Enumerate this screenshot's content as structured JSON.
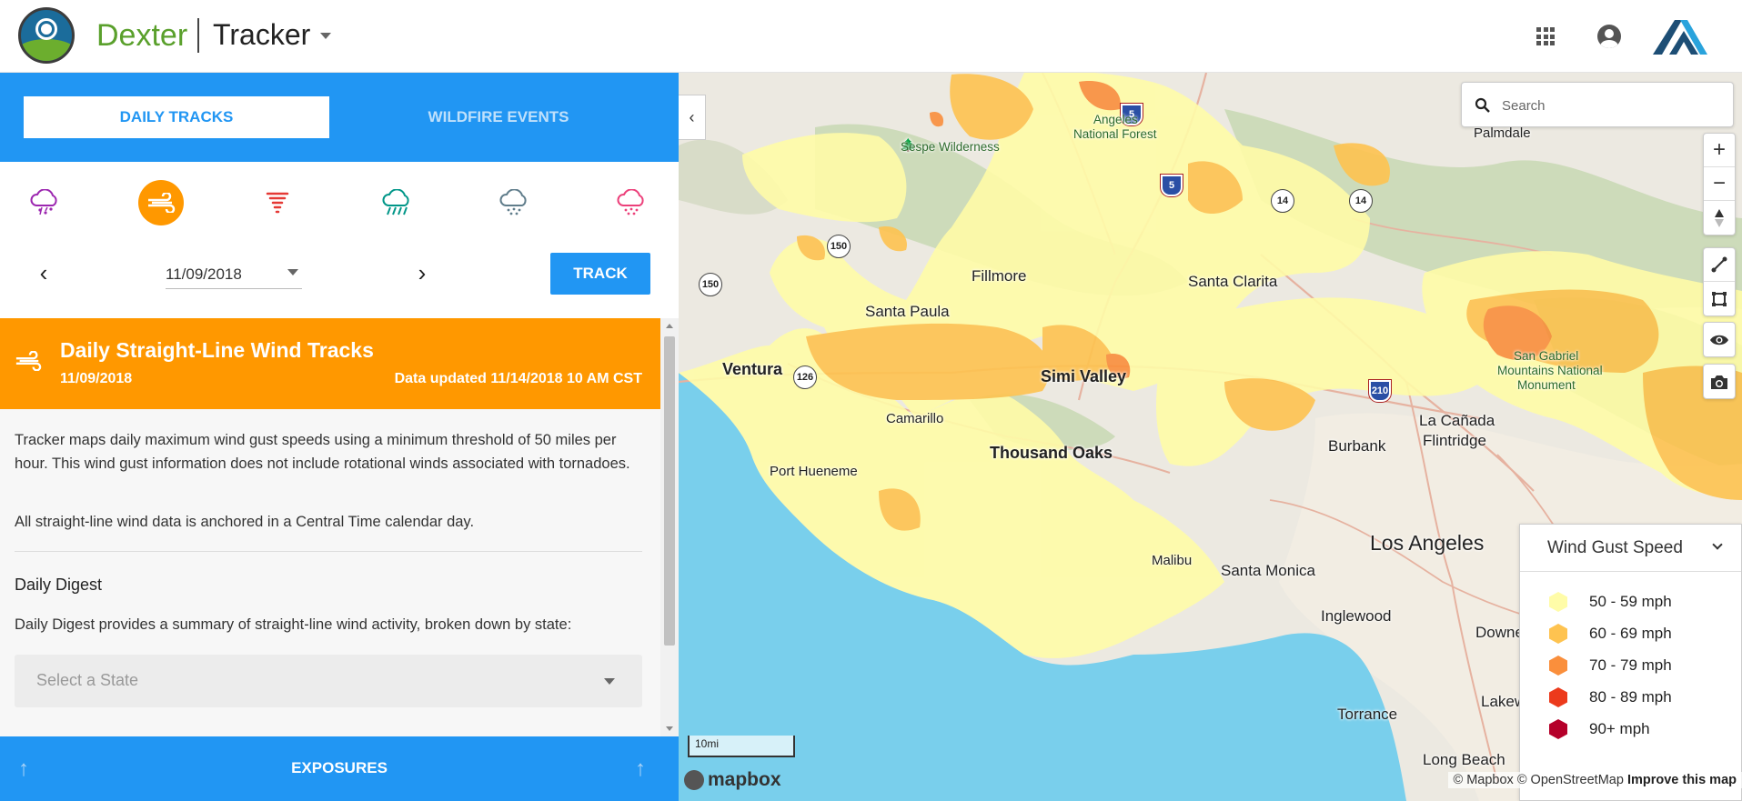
{
  "header": {
    "brand": "Dexter",
    "app_name": "Tracker"
  },
  "left_panel": {
    "tabs": [
      {
        "label": "DAILY TRACKS",
        "active": true
      },
      {
        "label": "WILDFIRE EVENTS",
        "active": false
      }
    ],
    "hazard_icons": [
      {
        "icon": "hail-icon",
        "color": "#9c27b0",
        "active": false
      },
      {
        "icon": "wind-icon",
        "color": "#ff9800",
        "active": true
      },
      {
        "icon": "tornado-icon",
        "color": "#e53935",
        "active": false
      },
      {
        "icon": "heavy-rain-icon",
        "color": "#009688",
        "active": false
      },
      {
        "icon": "winter-storm-icon",
        "color": "#607d8b",
        "active": false
      },
      {
        "icon": "wildfire-icon",
        "color": "#ec407a",
        "active": false
      }
    ],
    "date": "11/09/2018",
    "track_label": "TRACK",
    "banner": {
      "title": "Daily Straight-Line Wind Tracks",
      "date": "11/09/2018",
      "updated": "Data updated 11/14/2018 10 AM CST"
    },
    "description_1": "Tracker maps daily maximum wind gust speeds using a minimum threshold of 50 miles per hour. This wind gust information does not include rotational winds associated with tornadoes.",
    "description_2": "All straight-line wind data is anchored in a Central Time calendar day.",
    "digest_heading": "Daily Digest",
    "digest_text": "Daily Digest provides a summary of straight-line wind activity, broken down by state:",
    "state_placeholder": "Select a State",
    "exposures_label": "EXPOSURES"
  },
  "map": {
    "search_placeholder": "Search",
    "places": {
      "palmdale": "Palmdale",
      "sespe": "Sespe Wilderness",
      "angeles_1": "Angeles",
      "angeles_2": "National Forest",
      "fillmore": "Fillmore",
      "santa_clarita": "Santa Clarita",
      "santa_paula": "Santa Paula",
      "ventura": "Ventura",
      "simi_valley": "Simi Valley",
      "camarillo": "Camarillo",
      "thousand_oaks": "Thousand Oaks",
      "port_hueneme": "Port Hueneme",
      "burbank": "Burbank",
      "la_canada_1": "La Cañada",
      "la_canada_2": "Flintridge",
      "san_gabriel_1": "San Gabriel",
      "san_gabriel_2": "Mountains National",
      "san_gabriel_3": "Monument",
      "los_angeles": "Los Angeles",
      "malibu": "Malibu",
      "santa_monica": "Santa Monica",
      "inglewood": "Inglewood",
      "downey": "Downe",
      "lakewood": "Lakew",
      "torrance": "Torrance",
      "long_beach": "Long Beach"
    },
    "route_shields": {
      "i5_north": "5",
      "i5_south": "5",
      "r14_a": "14",
      "r14_b": "14",
      "r150_a": "150",
      "r150_b": "150",
      "r126": "126",
      "i210": "210"
    },
    "legend": {
      "title": "Wind Gust Speed",
      "items": [
        {
          "label": "50 - 59 mph",
          "color": "#fffca8"
        },
        {
          "label": "60 - 69 mph",
          "color": "#fec350"
        },
        {
          "label": "70 - 79 mph",
          "color": "#fa8f3c"
        },
        {
          "label": "80 - 89 mph",
          "color": "#ec3a1c"
        },
        {
          "label": "90+ mph",
          "color": "#b5002a"
        }
      ]
    },
    "scale_label": "10mi",
    "mapbox_label": "mapbox",
    "attribution": "© Mapbox © OpenStreetMap",
    "improve_label": "Improve this map"
  }
}
